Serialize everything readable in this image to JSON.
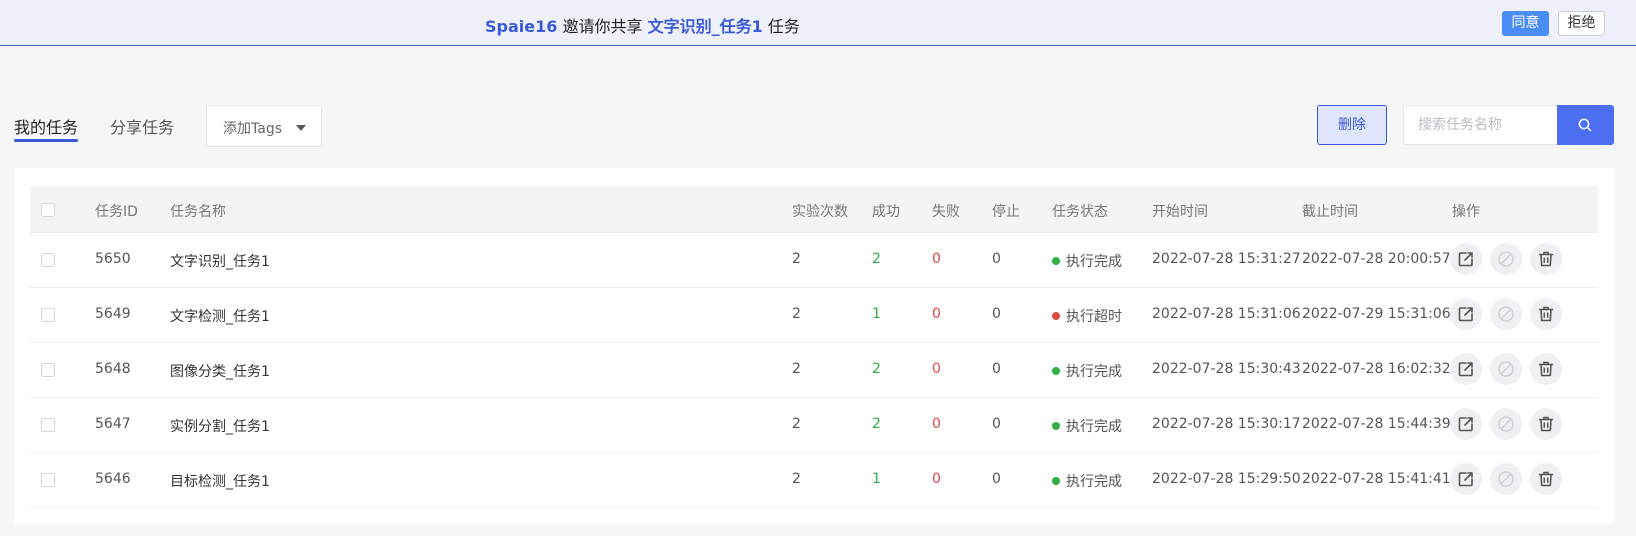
{
  "banner": {
    "inviter": "Spaie16",
    "middle": " 邀请你共享 ",
    "task": "文字识别_任务1",
    "suffix": " 任务",
    "agree": "同意",
    "reject": "拒绝"
  },
  "tabs": {
    "mine": "我的任务",
    "shared": "分享任务"
  },
  "tags_select": {
    "placeholder": "添加Tags"
  },
  "toolbar": {
    "delete": "删除",
    "search_placeholder": "搜索任务名称"
  },
  "table": {
    "headers": {
      "id": "任务ID",
      "name": "任务名称",
      "runs": "实验次数",
      "success": "成功",
      "fail": "失败",
      "stop": "停止",
      "status": "任务状态",
      "start": "开始时间",
      "end": "截止时间",
      "actions": "操作"
    },
    "rows": [
      {
        "id": "5650",
        "name": "文字识别_任务1",
        "runs": "2",
        "success": "2",
        "fail": "0",
        "stop": "0",
        "status": "执行完成",
        "status_color": "#2fae46",
        "start": "2022-07-28 15:31:27",
        "end": "2022-07-28 20:00:57"
      },
      {
        "id": "5649",
        "name": "文字检测_任务1",
        "runs": "2",
        "success": "1",
        "fail": "0",
        "stop": "0",
        "status": "执行超时",
        "status_color": "#e04848",
        "start": "2022-07-28 15:31:06",
        "end": "2022-07-29 15:31:06"
      },
      {
        "id": "5648",
        "name": "图像分类_任务1",
        "runs": "2",
        "success": "2",
        "fail": "0",
        "stop": "0",
        "status": "执行完成",
        "status_color": "#2fae46",
        "start": "2022-07-28 15:30:43",
        "end": "2022-07-28 16:02:32"
      },
      {
        "id": "5647",
        "name": "实例分割_任务1",
        "runs": "2",
        "success": "2",
        "fail": "0",
        "stop": "0",
        "status": "执行完成",
        "status_color": "#2fae46",
        "start": "2022-07-28 15:30:17",
        "end": "2022-07-28 15:44:39"
      },
      {
        "id": "5646",
        "name": "目标检测_任务1",
        "runs": "2",
        "success": "1",
        "fail": "0",
        "stop": "0",
        "status": "执行完成",
        "status_color": "#2fae46",
        "start": "2022-07-28 15:29:50",
        "end": "2022-07-28 15:41:41"
      }
    ]
  },
  "actions": {
    "share": "share-icon",
    "stop": "stop-icon",
    "delete": "trash-icon"
  },
  "colors": {
    "accent": "#3a5bd9",
    "success": "#2fae46",
    "fail": "#e04848"
  }
}
